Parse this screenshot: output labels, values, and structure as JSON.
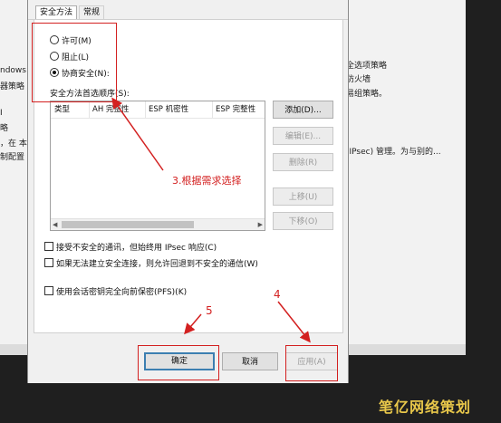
{
  "background": {
    "left_fragments": [
      "ndows",
      "器策略",
      "",
      "",
      "略",
      "，在 本",
      "制配置"
    ],
    "right_fragments": [
      "全选项策略",
      "防火墙",
      "易组策略。",
      "(IPsec) 管理。为与别的..."
    ]
  },
  "dialog": {
    "tabs": [
      {
        "label": "安全方法",
        "active": true
      },
      {
        "label": "常规",
        "active": false
      }
    ],
    "radios": [
      {
        "label": "许可(M)",
        "checked": false
      },
      {
        "label": "阻止(L)",
        "checked": false
      },
      {
        "label": "协商安全(N):",
        "checked": true
      }
    ],
    "list_label": "安全方法首选顺序(S):",
    "list_columns": [
      "类型",
      "AH 完整性",
      "ESP 机密性",
      "ESP 完整性"
    ],
    "side_buttons": [
      {
        "label": "添加(D)...",
        "enabled": true
      },
      {
        "label": "编辑(E)...",
        "enabled": false
      },
      {
        "label": "删除(R)",
        "enabled": false
      },
      {
        "label": "上移(U)",
        "enabled": false
      },
      {
        "label": "下移(O)",
        "enabled": false
      }
    ],
    "checks": [
      {
        "label": "接受不安全的通讯，但始终用 IPsec 响应(C)"
      },
      {
        "label": "如果无法建立安全连接，则允许回退到不安全的通信(W)"
      },
      {
        "label": "使用会话密钥完全向前保密(PFS)(K)"
      }
    ],
    "footer_buttons": {
      "ok": "确定",
      "cancel": "取消",
      "apply": "应用(A)"
    }
  },
  "annotations": {
    "step3": "3.根据需求选择",
    "step4": "4",
    "step5": "5",
    "color": "#d32020"
  },
  "watermark": "笔亿网络策划"
}
